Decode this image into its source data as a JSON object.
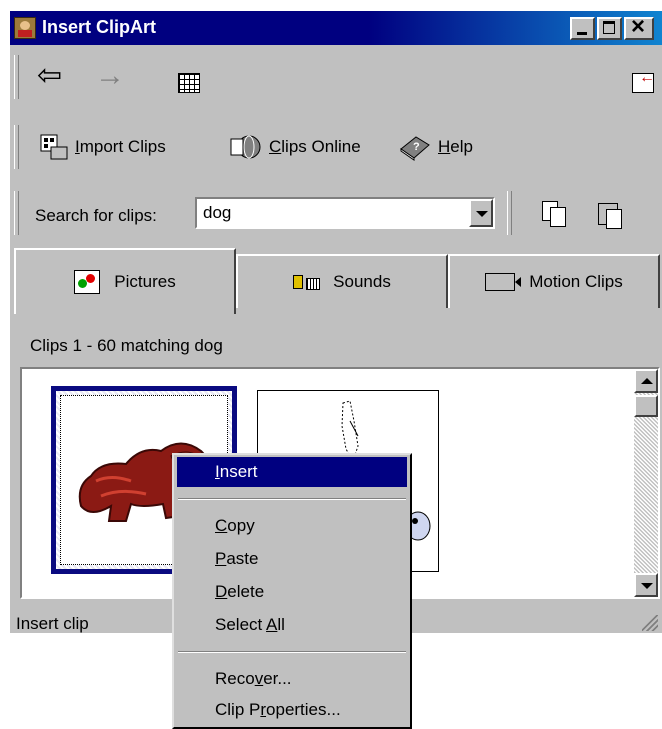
{
  "window": {
    "title": "Insert ClipArt"
  },
  "toolbar1": {
    "back": "⇦",
    "forward": "→"
  },
  "toolbar2": {
    "import_label_u": "I",
    "import_label_rest": "mport Clips",
    "online_label_u": "C",
    "online_label_rest": "lips Online",
    "help_label_u": "H",
    "help_label_rest": "elp"
  },
  "search": {
    "label": "Search for clips:",
    "value": "dog"
  },
  "tabs": [
    {
      "label": "Pictures",
      "icon": "pictures-icon"
    },
    {
      "label": "Sounds",
      "icon": "sounds-icon"
    },
    {
      "label": "Motion Clips",
      "icon": "motion-clips-icon"
    }
  ],
  "results": {
    "count_text": "Clips 1 - 60 matching dog"
  },
  "status": {
    "text": "Insert clip"
  },
  "context_menu": {
    "insert_u": "I",
    "insert_rest": "nsert",
    "copy_u": "C",
    "copy_rest": "opy",
    "paste_u": "P",
    "paste_rest": "aste",
    "delete_u": "D",
    "delete_rest": "elete",
    "selectall_pre": "Select ",
    "selectall_u": "A",
    "selectall_rest": "ll",
    "recover_pre": "Reco",
    "recover_u": "v",
    "recover_rest": "er...",
    "props_pre": "Clip P",
    "props_u": "r",
    "props_rest": "operties..."
  },
  "colors": {
    "titlebar": "#000080",
    "face": "#c0c0c0",
    "highlight": "#000080"
  }
}
